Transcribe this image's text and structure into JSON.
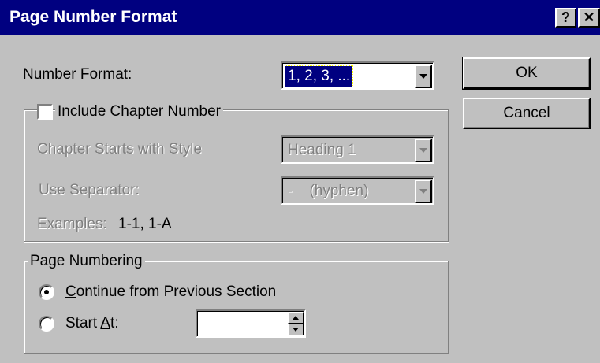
{
  "window": {
    "title": "Page Number Format",
    "help_glyph": "?",
    "close_glyph": "✕"
  },
  "number_format": {
    "label_prefix": "Number ",
    "label_accel": "F",
    "label_suffix": "ormat:",
    "value": "1, 2, 3, ..."
  },
  "chapter_group": {
    "caption_prefix": "Include Chapter ",
    "caption_accel": "N",
    "caption_suffix": "umber",
    "checked": false,
    "style_label": "Chapter Starts with Style",
    "style_value": "Heading 1",
    "separator_label": "Use Separator:",
    "separator_value": "-    (hyphen)",
    "examples_label": "Examples:",
    "examples_value": "1-1, 1-A"
  },
  "page_numbering": {
    "caption": "Page Numbering",
    "continue_accel": "C",
    "continue_rest": "ontinue from Previous Section",
    "start_prefix": "Start ",
    "start_accel": "A",
    "start_suffix": "t:",
    "start_value": "",
    "selected_option": "continue"
  },
  "buttons": {
    "ok": "OK",
    "cancel": "Cancel"
  },
  "colors": {
    "titlebar": "#000080",
    "face": "#c0c0c0",
    "disabled_text": "#808080"
  }
}
